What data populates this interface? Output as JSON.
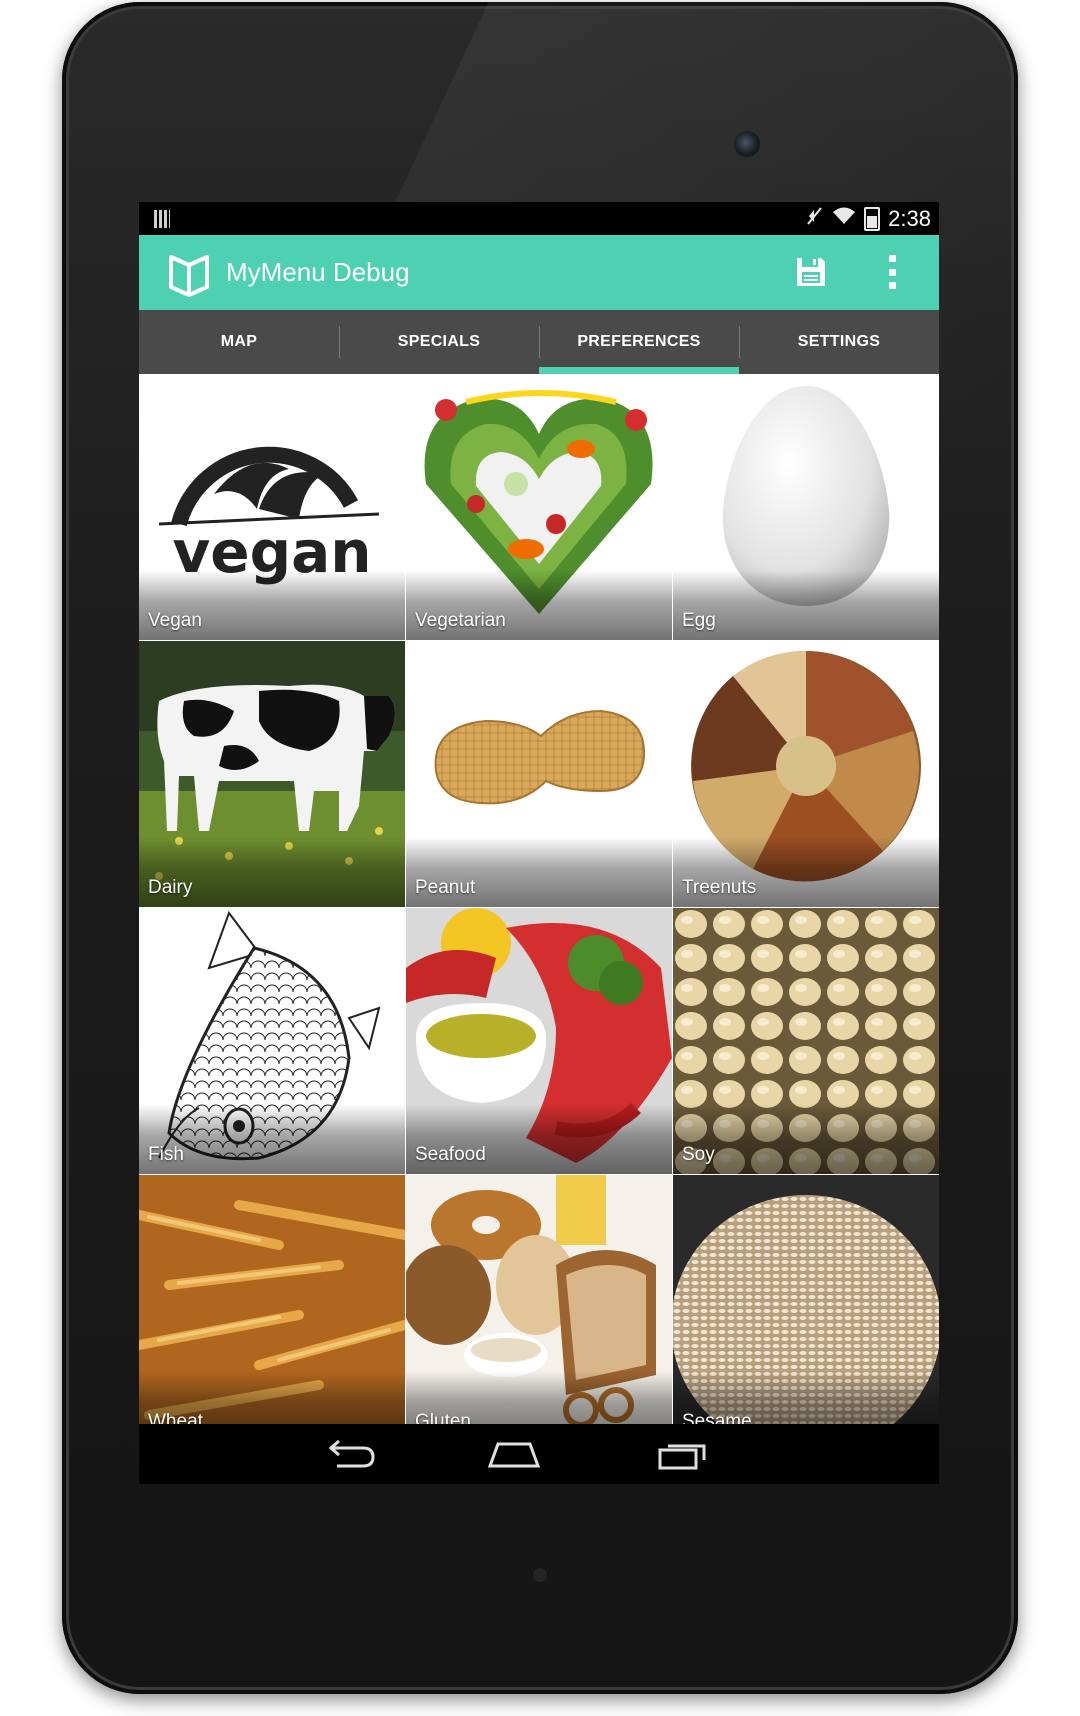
{
  "status_bar": {
    "time": "2:38",
    "icons": [
      "notification-icon",
      "mute-icon",
      "wifi-icon",
      "battery-charging-icon"
    ]
  },
  "action_bar": {
    "title": "MyMenu Debug",
    "logo_icon": "menu-book-icon",
    "actions": [
      "save-icon",
      "overflow-menu-icon"
    ],
    "color": "#4dd1b2"
  },
  "tabs": {
    "items": [
      {
        "label": "MAP"
      },
      {
        "label": "SPECIALS"
      },
      {
        "label": "PREFERENCES",
        "active": true
      },
      {
        "label": "SETTINGS"
      }
    ],
    "indicator_color": "#4dd1b2",
    "background": "#4a4a4a"
  },
  "preferences": {
    "items": [
      {
        "label": "Vegan"
      },
      {
        "label": "Vegetarian"
      },
      {
        "label": "Egg"
      },
      {
        "label": "Dairy"
      },
      {
        "label": "Peanut"
      },
      {
        "label": "Treenuts"
      },
      {
        "label": "Fish"
      },
      {
        "label": "Seafood"
      },
      {
        "label": "Soy"
      },
      {
        "label": "Wheat"
      },
      {
        "label": "Gluten"
      },
      {
        "label": "Sesame"
      }
    ],
    "vegan_logo_text": "vegan"
  },
  "nav_bar": {
    "buttons": [
      "back-icon",
      "home-icon",
      "recents-icon"
    ]
  }
}
